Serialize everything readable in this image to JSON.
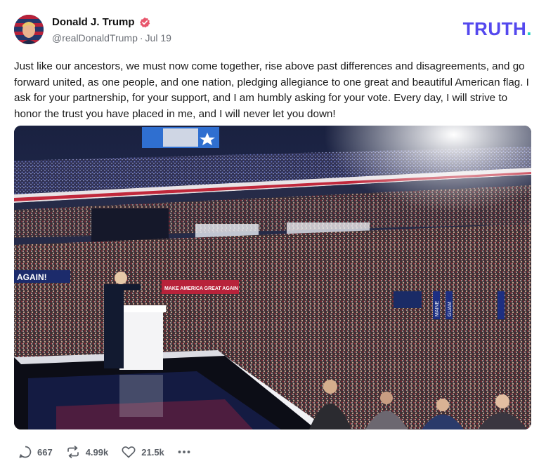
{
  "post": {
    "author_name": "Donald J. Trump",
    "handle": "@realDonaldTrump",
    "date": "Jul 19",
    "verified": true,
    "text": "Just like our ancestors, we must now come together, rise above past differences and disagreements, and go forward united, as one people, and one nation, pledging allegiance to one great and beautiful American flag. I ask for your partnership, for your support, and I am humbly asking for your vote. Every day, I will strive to honor the trust you have placed in me, and I will never let you down!"
  },
  "brand": {
    "logo_text": "TRUTH",
    "logo_dot": ".",
    "logo_color": "#5448ee",
    "dot_color": "#22d1c0",
    "verified_color": "#e8566c"
  },
  "media": {
    "signs": {
      "again": "AGAIN!",
      "mmaga": "MAKE AMERICA GREAT AGAIN",
      "maine": "MAINE",
      "guam": "GUAM"
    }
  },
  "actions": {
    "replies": "667",
    "retruths": "4.99k",
    "likes": "21.5k",
    "more_icon": "ellipsis-icon"
  }
}
